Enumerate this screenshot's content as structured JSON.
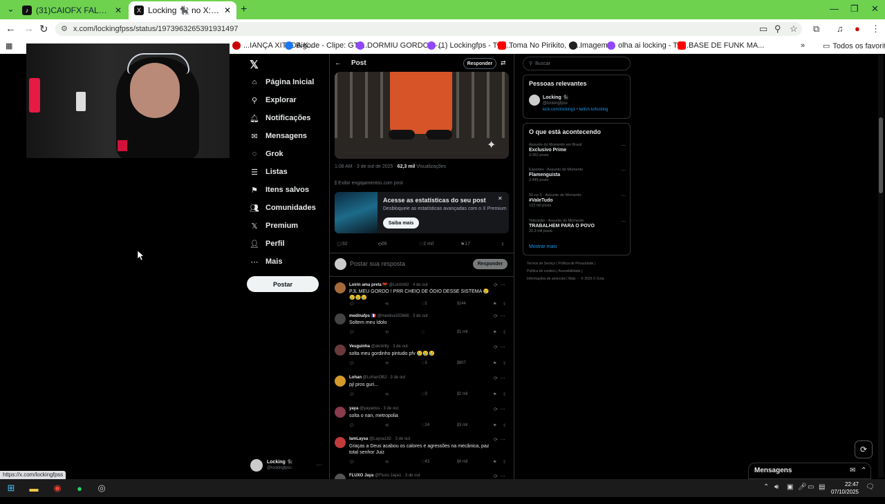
{
  "browser": {
    "tabs": [
      {
        "title": "(31)CAIOFX FALANDO DO ALB...",
        "favicon": "tiktok-icon"
      },
      {
        "title": "Locking 🐈‍⬛ no X: \"explica pra u",
        "favicon": "x-icon"
      }
    ],
    "url": "x.com/lockingfpss/status/1973963265391931497",
    "bookmarks": [
      {
        "label": "...IANÇA XITADA K...",
        "color": "#c00"
      },
      {
        "label": "Bigode - Clipe: GTA...",
        "color": "#1877f2"
      },
      {
        "label": "DORMIU GORDO? -...",
        "color": "#9146ff"
      },
      {
        "label": "(1) Lockingfps - Twit...",
        "color": "#9146ff"
      },
      {
        "label": "Toma No Pirikito, Q...",
        "color": "#ff0000"
      },
      {
        "label": "Imagem",
        "color": "#222"
      },
      {
        "label": "olha ai locking - Twi...",
        "color": "#9146ff"
      },
      {
        "label": "BASE DE FUNK MA...",
        "color": "#ff0000"
      }
    ],
    "favorites_label": "Todos os favoritos",
    "status_url": "https://x.com/lockingfpss"
  },
  "sidebar": {
    "items": [
      {
        "label": "Página Inicial",
        "icon": "⌂",
        "name": "home"
      },
      {
        "label": "Explorar",
        "icon": "⚲",
        "name": "explore"
      },
      {
        "label": "Notificações",
        "icon": "🔔︎",
        "name": "notifications"
      },
      {
        "label": "Mensagens",
        "icon": "✉",
        "name": "messages"
      },
      {
        "label": "Grok",
        "icon": "◌",
        "name": "grok"
      },
      {
        "label": "Listas",
        "icon": "☰",
        "name": "lists"
      },
      {
        "label": "Itens salvos",
        "icon": "⚑",
        "name": "bookmarks"
      },
      {
        "label": "Comunidades",
        "icon": "👥︎",
        "name": "communities"
      },
      {
        "label": "Premium",
        "icon": "𝕏",
        "name": "premium"
      },
      {
        "label": "Perfil",
        "icon": "👤︎",
        "name": "profile"
      },
      {
        "label": "Mais",
        "icon": "⋯",
        "name": "more"
      }
    ],
    "post_button": "Postar",
    "account": {
      "name": "Locking 🐈‍⬛",
      "handle": "@lockingfpss"
    }
  },
  "post": {
    "header_title": "Post",
    "reply_button": "Responder",
    "meta_time": "1:08 AM · 3 de out de 2025 · ",
    "meta_views": "62,3 mil",
    "meta_views_label": " Visualizações",
    "engagement_link": "Exibir engajamentos.com post",
    "promo": {
      "title": "Acesse as estatísticas do seu post",
      "desc": "Desbloqueie as estatísticas avançadas com o X Premium",
      "button": "Saiba mais"
    },
    "actions": {
      "replies": "92",
      "reposts": "66",
      "likes": "2 mil",
      "bookmarks": "17"
    },
    "reply_placeholder": "Postar sua resposta",
    "reply_submit": "Responder"
  },
  "comments": [
    {
      "name": "Loirin ama preta 🇦🇴",
      "handle": "@LoirinM2",
      "time": "4 de out",
      "text": "PJL MEU GORDO ! PRR CHEIO DE ÓDIO DESSE SISTEMA 😢😢😢😢",
      "likes": "2",
      "views": "144",
      "avatar": "#a56a3c"
    },
    {
      "name": "medinafps 🇫🇷",
      "handle": "@medina333666",
      "time": "3 de out",
      "text": "Soltem meu ídolo",
      "likes": "",
      "views": "1 mil",
      "avatar": "#444"
    },
    {
      "name": "Vesguinha",
      "handle": "@akckitty",
      "time": "3 de out",
      "text": "solta meu gordinho pintudo pfv 😢😢😢",
      "likes": "3",
      "views": "807",
      "avatar": "#6a3a3a"
    },
    {
      "name": "Lohan",
      "handle": "@LohanOBJ",
      "time": "3 de out",
      "text": "pjl pros guri...",
      "likes": "3",
      "views": "2 mil",
      "avatar": "#d49a2a"
    },
    {
      "name": "yaya",
      "handle": "@yayaxiss",
      "time": "3 de out",
      "text": "solta o nan, metropolia",
      "likes": "24",
      "views": "3 mil",
      "avatar": "#8a3b4d"
    },
    {
      "name": "IamLaysa",
      "handle": "@Laysa182",
      "time": "3 de out",
      "text": "Graças a Deus acabou os calores e agressões na mecânica, paz total senhor Juiz",
      "likes": "43",
      "views": "4 mil",
      "avatar": "#c23b3b"
    },
    {
      "name": "FLUXO Jaya",
      "handle": "@Fluxo Jaya1",
      "time": "3 de out",
      "text": "",
      "likes": "",
      "views": "",
      "avatar": "#555"
    }
  ],
  "right": {
    "search_placeholder": "Buscar",
    "relevant_title": "Pessoas relevantes",
    "relevant": {
      "name": "Locking 🐈‍⬛",
      "handle": "@lockingfpss",
      "bio": "kick.com/locking1 • twitch.tv/locking"
    },
    "trending_title": "O que está acontecendo",
    "trends": [
      {
        "context": "Assunto do Momento em Brasil",
        "name": "Exclusivo Prime",
        "posts": "3.352 posts"
      },
      {
        "context": "Esportes · Assunto do Momento",
        "name": "Flamenguista",
        "posts": "2.445 posts"
      },
      {
        "context": "50.no X · Assunto do Momento",
        "name": "#ValeTudo",
        "posts": "123 mil posts"
      },
      {
        "context": "Televisão · Assunto do Momento",
        "name": "TRABALHEM PARA O POVO",
        "posts": "22,3 mil posts"
      }
    ],
    "show_more": "Mostrar mais",
    "footer": [
      "Termos de Serviço  |  Política de Privacidade  |",
      "Política de cookies  |  Acessibilidade  |",
      "Informações de anúncios  |  Mais ···  © 2025 X Corp."
    ]
  },
  "messages_bar": {
    "title": "Mensagens"
  },
  "taskbar": {
    "time": "22:47",
    "date": "07/10/2025"
  }
}
